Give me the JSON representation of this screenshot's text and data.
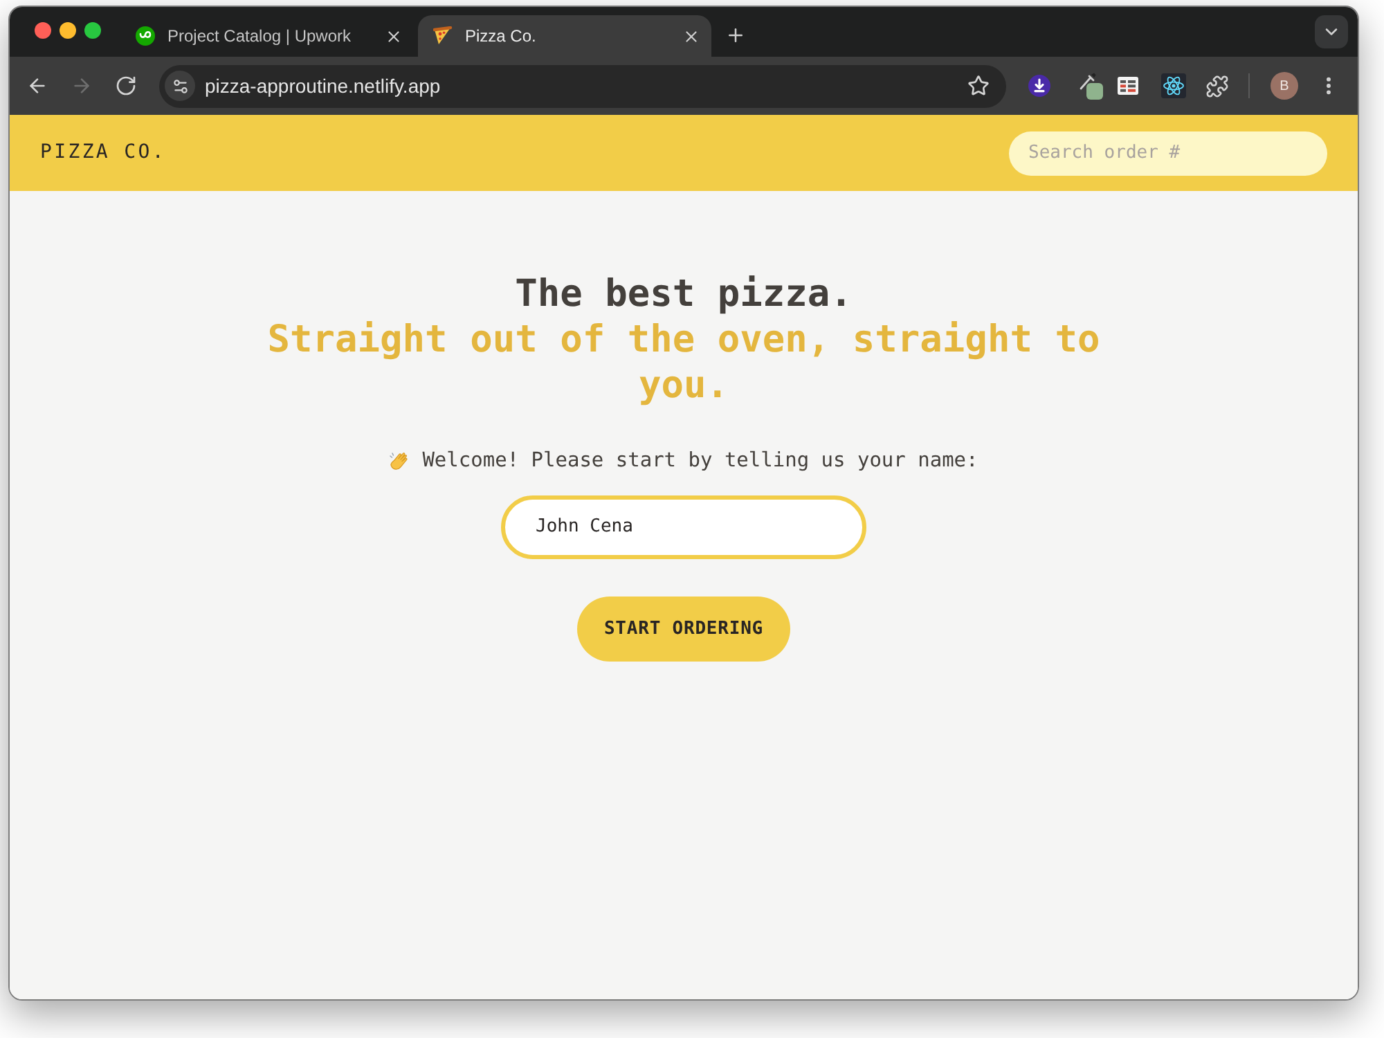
{
  "browser": {
    "tabs": [
      {
        "title": "Project Catalog | Upwork",
        "selected": false
      },
      {
        "title": "Pizza Co.",
        "selected": true
      }
    ],
    "navigation": [
      {
        "kind": "back",
        "disabled": false
      },
      {
        "kind": "forward",
        "disabled": true
      },
      {
        "kind": "reload",
        "disabled": false
      }
    ],
    "address_bar": {
      "url": "pizza-approutine.netlify.app"
    },
    "profile": {
      "initial": "B"
    }
  },
  "app": {
    "header": {
      "logo": "PIZZA CO.",
      "search": {
        "placeholder": "Search order #"
      }
    },
    "hero": {
      "title": "The best pizza.",
      "subtitle": "Straight out of the oven, straight to you."
    },
    "greeting": {
      "prompt": "Welcome! Please start by telling us your name:",
      "name_field": {
        "value": "John Cena"
      },
      "submit_button": "START ORDERING"
    }
  }
}
